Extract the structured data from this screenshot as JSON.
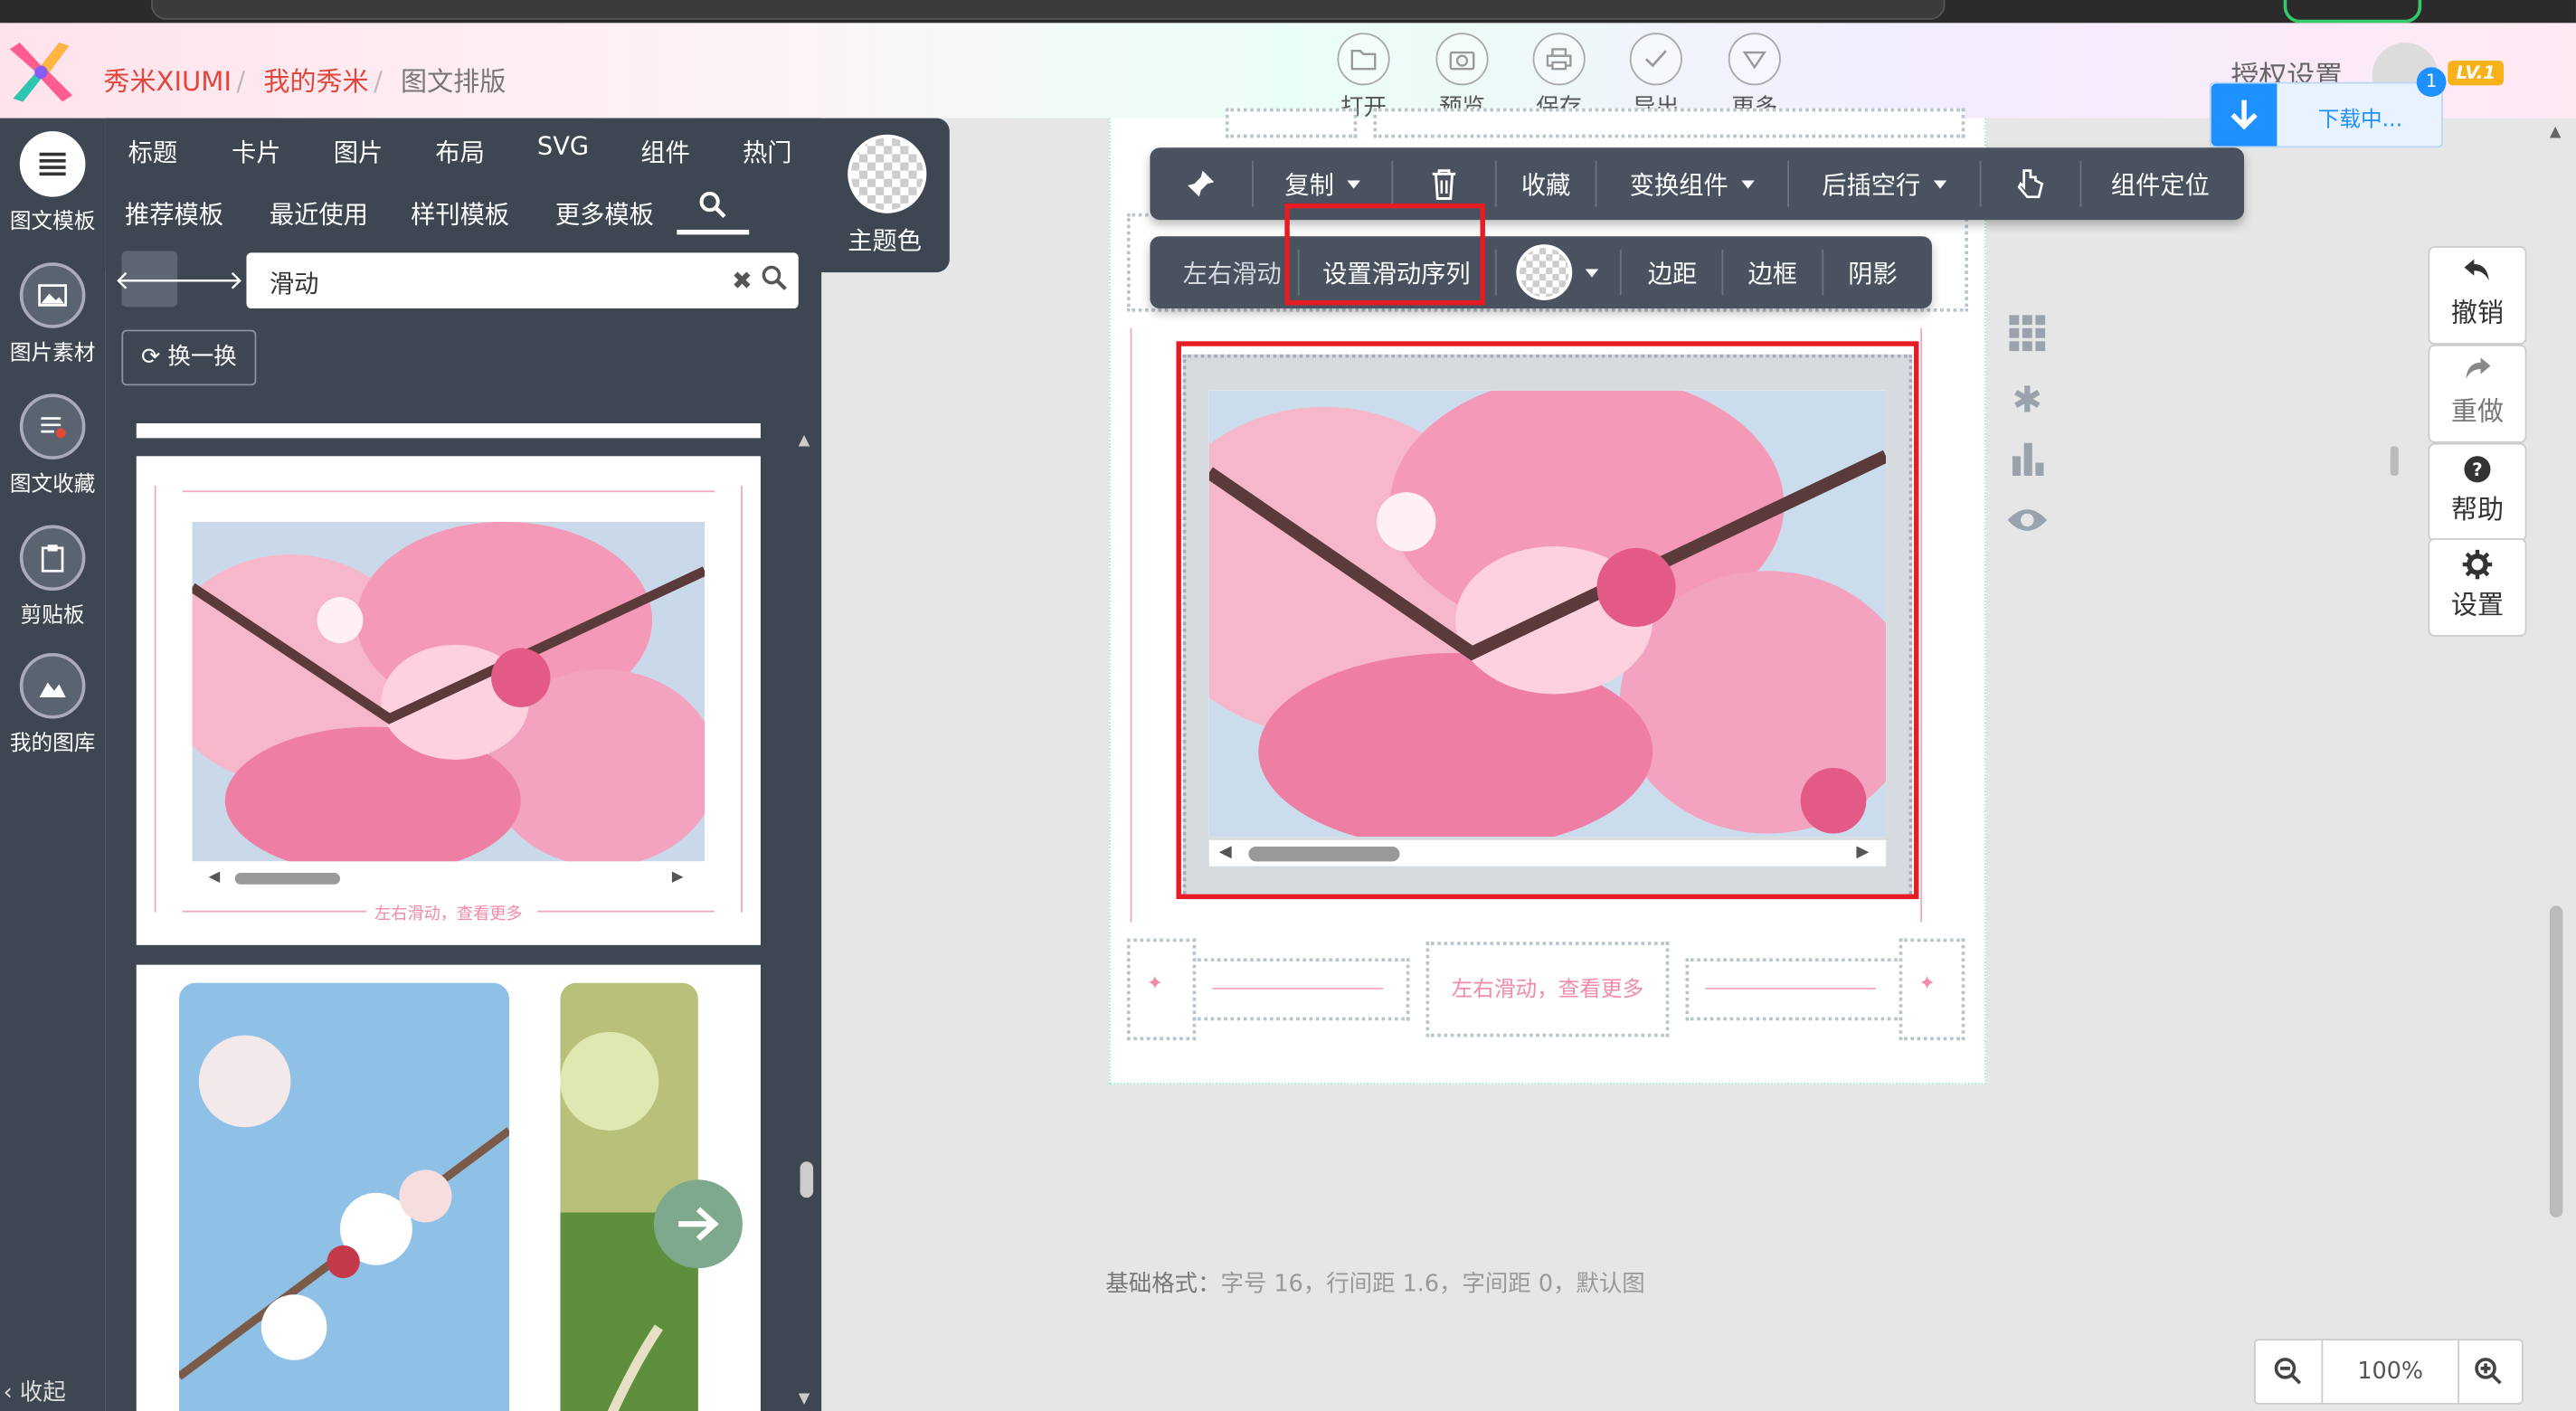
{
  "header": {
    "breadcrumb": [
      "秀米XIUMI",
      "我的秀米",
      "图文排版"
    ],
    "actions": [
      {
        "label": "打开",
        "icon": "folder-icon"
      },
      {
        "label": "预览",
        "icon": "camera-icon"
      },
      {
        "label": "保存",
        "icon": "printer-icon"
      },
      {
        "label": "导出",
        "icon": "check-icon"
      },
      {
        "label": "更多",
        "icon": "triangle-down-icon"
      }
    ],
    "auth_settings": "授权设置",
    "level_badge": "LV.1",
    "download": {
      "text": "下载中...",
      "count": "1"
    }
  },
  "sidebar": {
    "items": [
      {
        "label": "图文模板",
        "icon": "list-icon"
      },
      {
        "label": "图片素材",
        "icon": "image-icon"
      },
      {
        "label": "图文收藏",
        "icon": "favorite-list-icon"
      },
      {
        "label": "剪贴板",
        "icon": "clipboard-icon"
      },
      {
        "label": "我的图库",
        "icon": "gallery-icon"
      }
    ],
    "collapse": "收起"
  },
  "panel": {
    "tabs_row1": [
      "标题",
      "卡片",
      "图片",
      "布局",
      "SVG",
      "组件",
      "热门"
    ],
    "tabs_row2": [
      "推荐模板",
      "最近使用",
      "样刊模板",
      "更多模板"
    ],
    "theme_label": "主题色",
    "search_value": "滑动",
    "refresh_label": "换一换",
    "card1_caption": "左右滑动，查看更多"
  },
  "toolbar1": {
    "copy": "复制",
    "favorite": "收藏",
    "transform": "变换组件",
    "insert_after": "后插空行",
    "locate": "组件定位"
  },
  "toolbar2": {
    "swipe": "左右滑动",
    "set_swipe_order": "设置滑动序列",
    "margin": "边距",
    "border": "边框",
    "shadow": "阴影"
  },
  "canvas": {
    "swipe_caption": "左右滑动，查看更多"
  },
  "right_actions": [
    {
      "label": "撤销",
      "icon": "undo-icon"
    },
    {
      "label": "重做",
      "icon": "redo-icon"
    },
    {
      "label": "帮助",
      "icon": "help-icon"
    },
    {
      "label": "设置",
      "icon": "gear-icon"
    }
  ],
  "format": {
    "key": "基础格式：",
    "value": "字号 16，行间距 1.6，字间距 0，默认图"
  },
  "zoom": {
    "value": "100%"
  },
  "colors": {
    "accent_red": "#e2473b",
    "panel_bg": "#3e4651",
    "highlight": "#e51c23",
    "download_blue": "#1e90ff"
  }
}
